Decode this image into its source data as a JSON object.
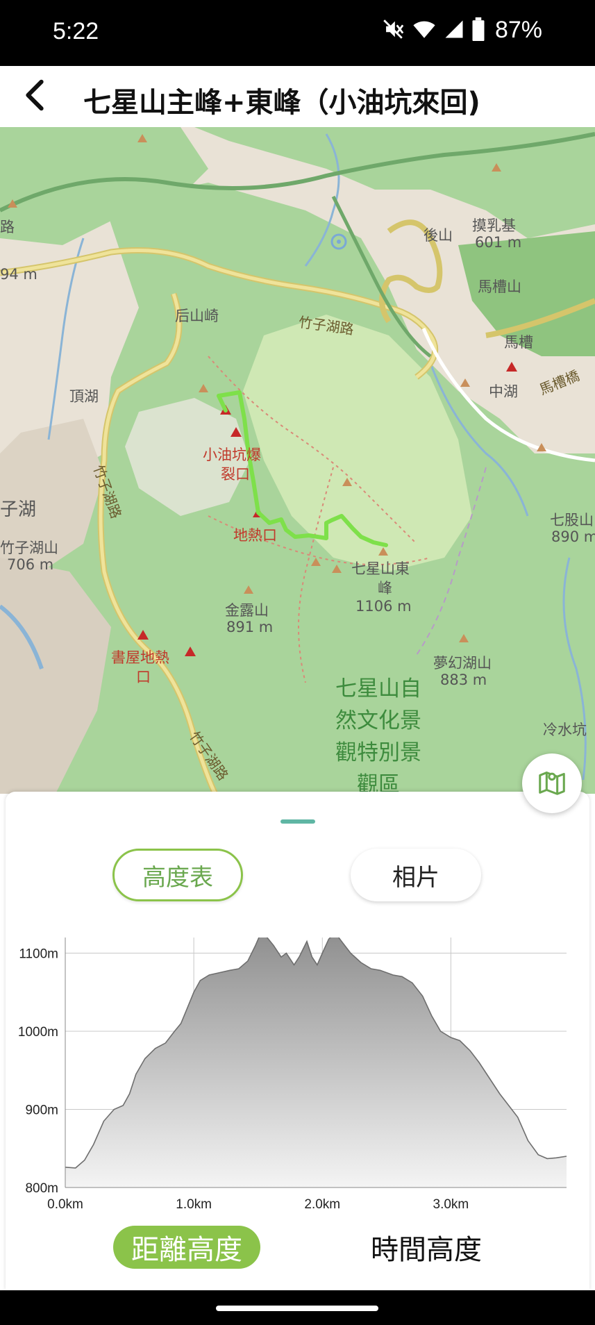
{
  "status_bar": {
    "time": "5:22",
    "battery": "87%",
    "icons": [
      "mute-icon",
      "wifi-icon",
      "cell-signal-icon",
      "battery-icon"
    ]
  },
  "header": {
    "title": "七星山主峰+東峰（小油坑來回)",
    "back_icon": "back-arrow-icon"
  },
  "map": {
    "labels": {
      "houshanqi": "后山崎",
      "zhuzihu_road_top": "竹子湖路",
      "houshan": "後山",
      "monaji": "摸乳基",
      "monaji_elev": "601 m",
      "macaoshan": "馬槽山",
      "macao": "馬槽",
      "zhonghu": "中湖",
      "macao_bridge": "馬槽橋",
      "dinghu": "頂湖",
      "xiaoyoukeng": "小油坑爆",
      "xiaoyoukeng2": "裂口",
      "dire": "地熱口",
      "dongfeng": "七星山東",
      "dongfeng2": "峰",
      "dongfeng_elev": "1106 m",
      "qigushan": "七股山",
      "qigushan_elev": "890 m",
      "zhuzihu_road_left": "竹子湖路",
      "zhuzihushan": "竹子湖山",
      "zhuzihushan_elev": "706 m",
      "zi_hu": "子湖",
      "jinbaoshan": "金露山",
      "jinbaoshan_elev": "891 m",
      "shuwu": "書屋地熱",
      "shuwu2": "口",
      "menghuanhu": "夢幻湖山",
      "menghuanhu_elev": "883 m",
      "park": "七星山自然文化景觀特別景觀區",
      "lengshuikeng": "冷水坑",
      "zhuzihu_road_bottom": "竹子湖路",
      "lu": "路",
      "lu_elev": "94 m"
    },
    "route_color": "#7ee04a",
    "toggle_icon": "map-layers-icon"
  },
  "bottom_sheet": {
    "tabs": [
      {
        "label": "高度表",
        "selected": true
      },
      {
        "label": "相片",
        "selected": false
      }
    ],
    "modes": [
      {
        "label": "距離高度",
        "selected": true
      },
      {
        "label": "時間高度",
        "selected": false
      }
    ],
    "accent_color": "#8bc34a"
  },
  "chart_data": {
    "type": "area",
    "xlabel": "",
    "ylabel": "",
    "x_ticks": [
      "0.0km",
      "1.0km",
      "2.0km",
      "3.0km"
    ],
    "y_ticks": [
      "800m",
      "900m",
      "1000m",
      "1100m"
    ],
    "xlim": [
      0,
      3.9
    ],
    "ylim": [
      800,
      1120
    ],
    "grid": true,
    "series": [
      {
        "x": [
          0.0,
          0.08,
          0.15,
          0.22,
          0.3,
          0.38,
          0.45,
          0.5,
          0.55,
          0.62,
          0.7,
          0.78,
          0.85,
          0.9,
          0.95,
          1.0,
          1.05,
          1.12,
          1.2,
          1.28,
          1.35,
          1.42,
          1.48,
          1.52,
          1.57,
          1.62,
          1.68,
          1.72,
          1.78,
          1.82,
          1.88,
          1.92,
          1.96,
          2.0,
          2.05,
          2.1,
          2.15,
          2.22,
          2.3,
          2.38,
          2.45,
          2.55,
          2.62,
          2.7,
          2.78,
          2.85,
          2.92,
          3.0,
          3.07,
          3.15,
          3.22,
          3.3,
          3.38,
          3.45,
          3.52,
          3.6,
          3.68,
          3.75,
          3.82,
          3.9
        ],
        "y": [
          826,
          825,
          835,
          855,
          885,
          900,
          905,
          920,
          945,
          965,
          978,
          985,
          1000,
          1010,
          1030,
          1050,
          1065,
          1072,
          1075,
          1078,
          1080,
          1090,
          1110,
          1125,
          1120,
          1110,
          1095,
          1100,
          1085,
          1095,
          1115,
          1095,
          1085,
          1100,
          1118,
          1126,
          1115,
          1100,
          1088,
          1080,
          1078,
          1072,
          1070,
          1062,
          1045,
          1020,
          1000,
          992,
          988,
          975,
          960,
          940,
          920,
          905,
          890,
          860,
          842,
          837,
          838,
          840
        ]
      }
    ]
  }
}
